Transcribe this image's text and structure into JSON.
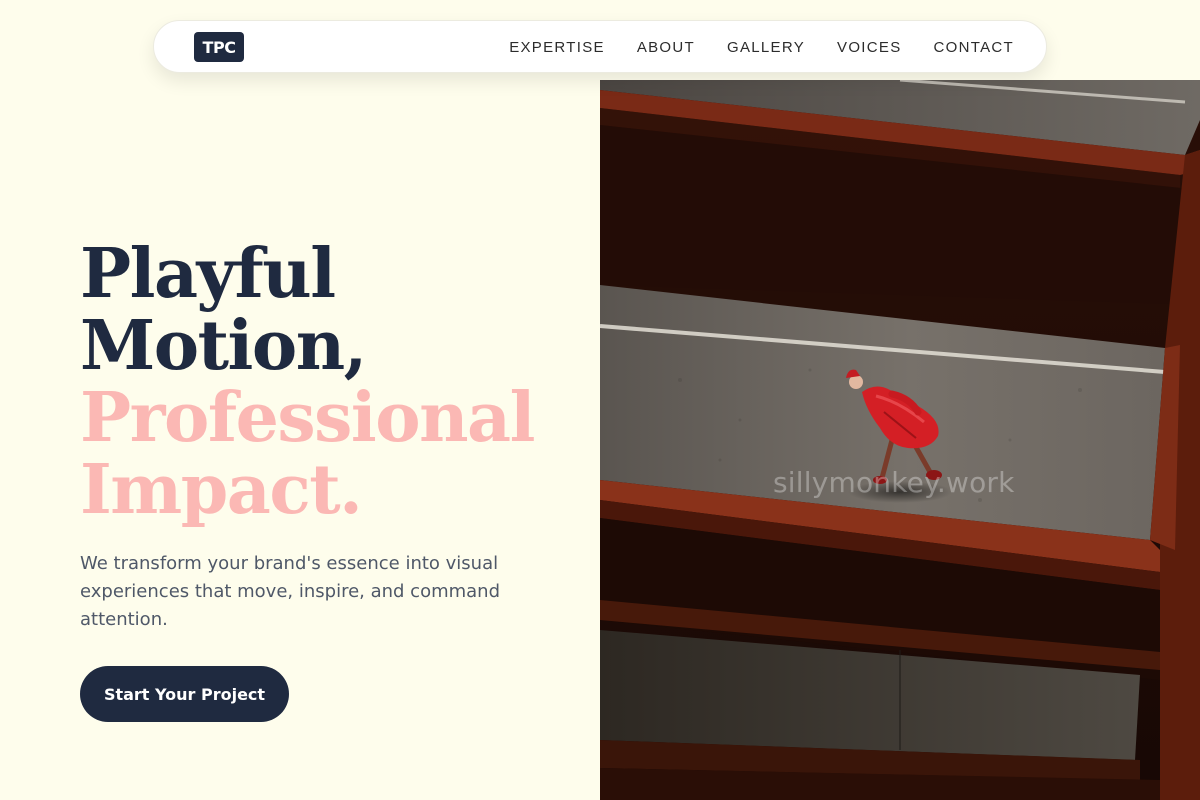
{
  "nav": {
    "logo": "TPC",
    "links": [
      "EXPERTISE",
      "ABOUT",
      "GALLERY",
      "VOICES",
      "CONTACT"
    ]
  },
  "hero": {
    "title_line1": "Playful",
    "title_line2": "Motion,",
    "title_line3": "Professional",
    "title_line4": "Impact.",
    "description": "We transform your brand's essence into visual experiences that move, inspire, and command attention.",
    "cta_label": "Start Your Project",
    "photo_watermark": "sillymonkey.work"
  },
  "colors": {
    "background": "#fefdec",
    "navy": "#1f2a40",
    "pink_accent": "#fbb8b4",
    "body_text": "#4f5868"
  }
}
